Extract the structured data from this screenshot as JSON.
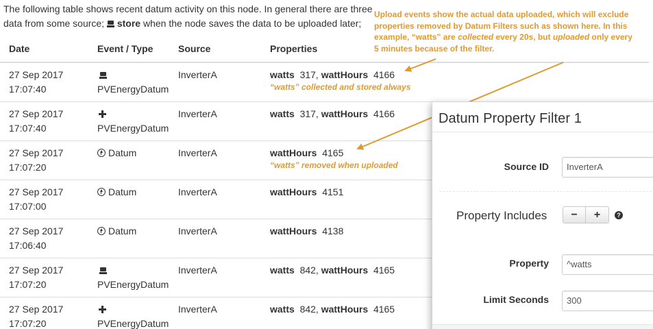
{
  "intro": {
    "line1": "The following table shows recent datum activity on this node. In general there are three",
    "line2_pre": "data from some source;",
    "line2_store": "store",
    "line2_post": "when the node saves the data to be uploaded later;"
  },
  "table": {
    "headers": {
      "date": "Date",
      "event": "Event / Type",
      "source": "Source",
      "properties": "Properties"
    },
    "rows": [
      {
        "date": "27 Sep 2017",
        "time": "17:07:40",
        "icon": "store-icon",
        "type": "PVEnergyDatum",
        "source": "InverterA",
        "k1": "watts",
        "v1": "317,",
        "k2": "wattHours",
        "v2": "4166",
        "note": "“watts” collected and stored always"
      },
      {
        "date": "27 Sep 2017",
        "time": "17:07:40",
        "icon": "plus-icon",
        "type": "PVEnergyDatum",
        "source": "InverterA",
        "k1": "watts",
        "v1": "317,",
        "k2": "wattHours",
        "v2": "4166"
      },
      {
        "date": "27 Sep 2017",
        "time": "17:07:20",
        "icon": "upload-icon",
        "type": "Datum",
        "source": "InverterA",
        "k1": "wattHours",
        "v1": "4165",
        "note": "“watts” removed when uploaded"
      },
      {
        "date": "27 Sep 2017",
        "time": "17:07:00",
        "icon": "upload-icon",
        "type": "Datum",
        "source": "InverterA",
        "k1": "wattHours",
        "v1": "4151"
      },
      {
        "date": "27 Sep 2017",
        "time": "17:06:40",
        "icon": "upload-icon",
        "type": "Datum",
        "source": "InverterA",
        "k1": "wattHours",
        "v1": "4138"
      },
      {
        "date": "27 Sep 2017",
        "time": "17:07:20",
        "icon": "store-icon",
        "type": "PVEnergyDatum",
        "source": "InverterA",
        "k1": "watts",
        "v1": "842,",
        "k2": "wattHours",
        "v2": "4165"
      },
      {
        "date": "27 Sep 2017",
        "time": "17:07:20",
        "icon": "plus-icon",
        "type": "PVEnergyDatum",
        "source": "InverterA",
        "k1": "watts",
        "v1": "842,",
        "k2": "wattHours",
        "v2": "4165"
      }
    ]
  },
  "callout": {
    "line1": "Upload events show the actual data uploaded, which will exclude",
    "line2": "properties removed by Datum Filters such as shown here. In this",
    "line3_a": "example, “watts” are",
    "line3_b": "collected",
    "line3_c": "every 20s, but",
    "line3_d": "uploaded",
    "line3_e": "only every",
    "line4": "5 minutes because of the filter."
  },
  "panel": {
    "title": "Datum Property Filter 1",
    "source_id_label": "Source ID",
    "source_id_value": "InverterA",
    "property_includes_label": "Property Includes",
    "minus_label": "−",
    "plus_label": "+",
    "help_label": "?",
    "property_label": "Property",
    "property_value": "^watts",
    "limit_seconds_label": "Limit Seconds",
    "limit_seconds_value": "300"
  },
  "colors": {
    "accent": "#e19a2e",
    "text": "#333333",
    "rule": "#dddddd"
  }
}
